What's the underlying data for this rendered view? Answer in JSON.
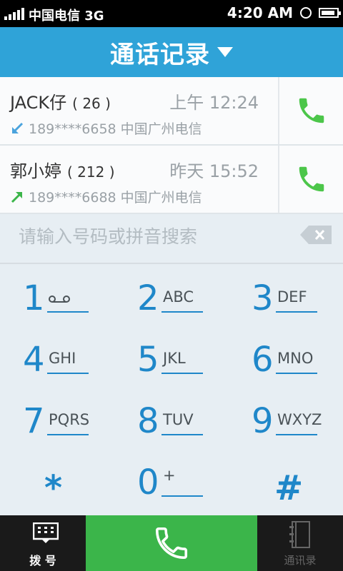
{
  "status": {
    "carrier": "中国电信 3G",
    "time": "4:20 AM"
  },
  "header": {
    "title": "通话记录"
  },
  "calls": [
    {
      "name": "JACK仔",
      "count": "( 26 )",
      "when": "上午 12:24",
      "info": "189****6658 中国广州电信",
      "direction": "incoming"
    },
    {
      "name": "郭小婷",
      "count": "( 212 )",
      "when": "昨天 15:52",
      "info": "189****6688 中国广州电信",
      "direction": "outgoing"
    }
  ],
  "search": {
    "placeholder": "请输入号码或拼音搜索"
  },
  "keys": [
    {
      "digit": "1",
      "letters": ""
    },
    {
      "digit": "2",
      "letters": "ABC"
    },
    {
      "digit": "3",
      "letters": "DEF"
    },
    {
      "digit": "4",
      "letters": "GHI"
    },
    {
      "digit": "5",
      "letters": "JKL"
    },
    {
      "digit": "6",
      "letters": "MNO"
    },
    {
      "digit": "7",
      "letters": "PQRS"
    },
    {
      "digit": "8",
      "letters": "TUV"
    },
    {
      "digit": "9",
      "letters": "WXYZ"
    },
    {
      "digit": "*",
      "letters": ""
    },
    {
      "digit": "0",
      "letters": "+"
    },
    {
      "digit": "#",
      "letters": ""
    }
  ],
  "tabs": {
    "dial": "拨 号",
    "contacts": "通讯录"
  },
  "colors": {
    "accent": "#2fa3d8",
    "call_green": "#3bb54a",
    "digit_blue": "#1f87c9"
  }
}
